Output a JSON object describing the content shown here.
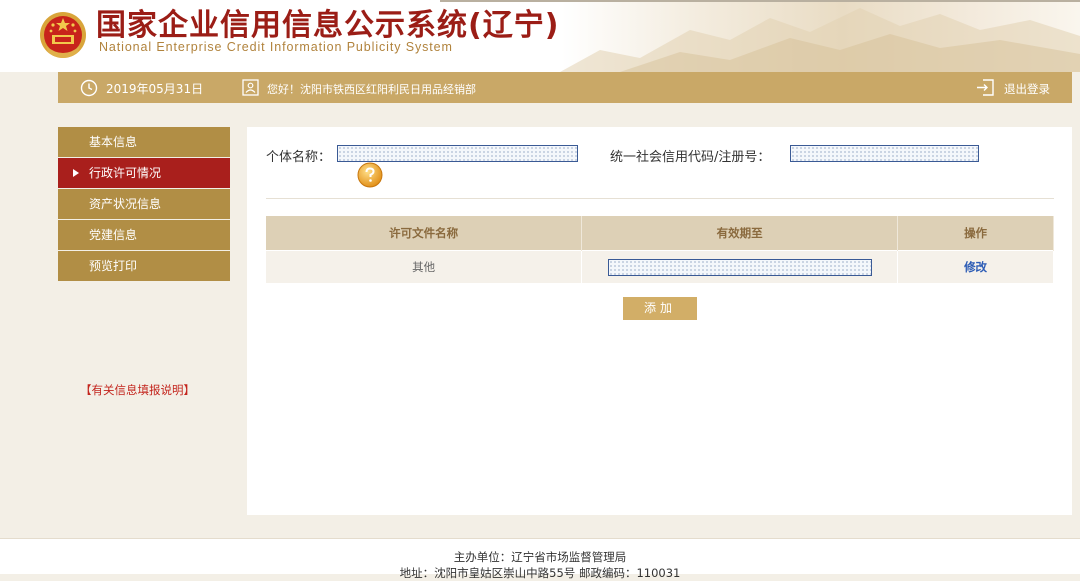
{
  "header": {
    "title_cn": "国家企业信用信息公示系统(辽宁)",
    "title_en": "National Enterprise Credit Information Publicity System"
  },
  "infobar": {
    "date": "2019年05月31日",
    "greeting": "您好！沈阳市铁西区红阳利民日用品经销部",
    "logout_label": "退出登录"
  },
  "sidebar": {
    "items": [
      {
        "label": "基本信息",
        "active": false
      },
      {
        "label": "行政许可情况",
        "active": true
      },
      {
        "label": "资产状况信息",
        "active": false
      },
      {
        "label": "党建信息",
        "active": false
      },
      {
        "label": "预览打印",
        "active": false
      }
    ],
    "help_link": "【有关信息填报说明】"
  },
  "form": {
    "name_label": "个体名称：",
    "name_value": "",
    "code_label": "统一社会信用代码/注册号：",
    "code_value": ""
  },
  "table": {
    "headers": [
      "许可文件名称",
      "有效期至",
      "操作"
    ],
    "rows": [
      {
        "name": "其他",
        "valid_until": "",
        "action": "修改"
      }
    ]
  },
  "add_button": "添加",
  "footer": {
    "line1": "主办单位：辽宁省市场监督管理局",
    "line2": "地址：沈阳市皇姑区崇山中路55号 邮政编码：110031"
  },
  "colors": {
    "brand_red": "#9b1d16",
    "gold": "#c9a867",
    "sidebar_active": "#a91f1c",
    "link_blue": "#2b5bb5"
  }
}
